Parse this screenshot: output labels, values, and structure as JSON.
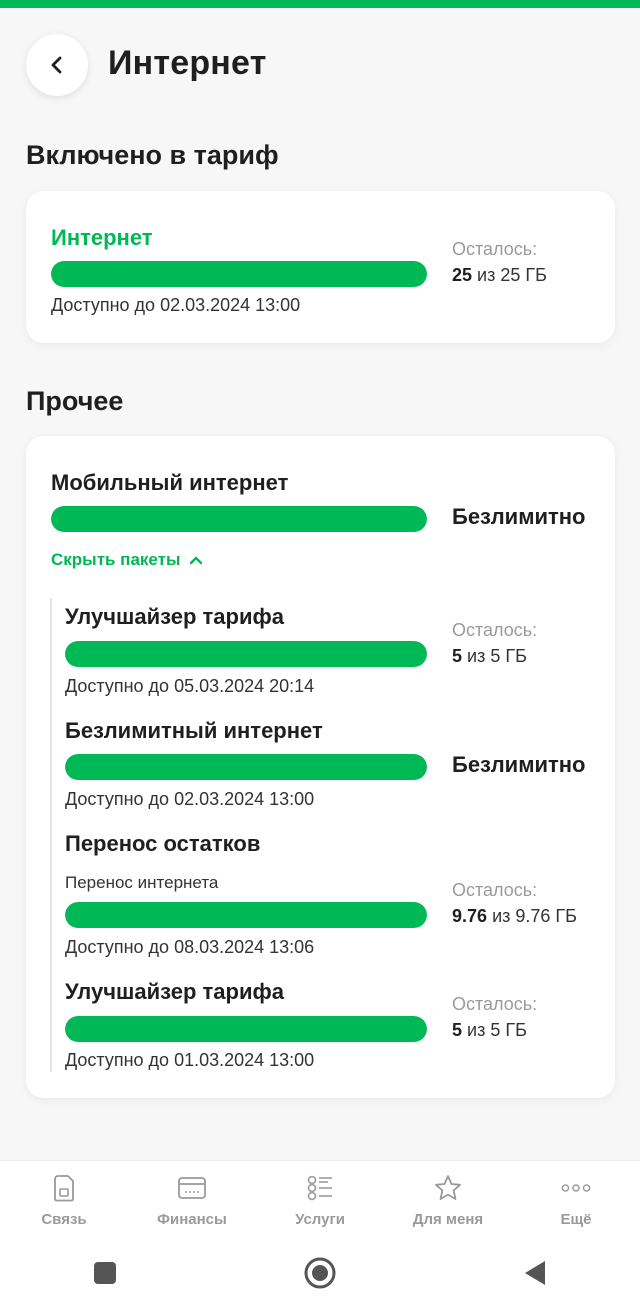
{
  "header": {
    "title": "Интернет"
  },
  "sections": {
    "included_title": "Включено в тариф",
    "other_title": "Прочее"
  },
  "included": {
    "name": "Интернет",
    "available": "Доступно до 02.03.2024 13:00",
    "remaining_label": "Осталось:",
    "remaining_value": "25",
    "remaining_suffix": "из 25 ГБ",
    "fill_fraction": 1.0
  },
  "other": {
    "mobile": {
      "name": "Мобильный интернет",
      "status": "Безлимитно",
      "fill_fraction": 1.0
    },
    "toggle_label": "Скрыть пакеты",
    "packages": [
      {
        "name": "Улучшайзер тарифа",
        "available": "Доступно до 05.03.2024 20:14",
        "remaining_label": "Осталось:",
        "remaining_value": "5",
        "remaining_suffix": "из 5 ГБ",
        "fill_fraction": 1.0
      },
      {
        "name": "Безлимитный интернет",
        "available": "Доступно до 02.03.2024 13:00",
        "status": "Безлимитно",
        "fill_fraction": 1.0
      },
      {
        "name": "Перенос остатков",
        "subtitle": "Перенос интернета",
        "available": "Доступно до 08.03.2024 13:06",
        "remaining_label": "Осталось:",
        "remaining_value": "9.76",
        "remaining_suffix": "из 9.76 ГБ",
        "fill_fraction": 1.0
      },
      {
        "name": "Улучшайзер тарифа",
        "available": "Доступно до 01.03.2024 13:00",
        "remaining_label": "Осталось:",
        "remaining_value": "5",
        "remaining_suffix": "из 5 ГБ",
        "fill_fraction": 1.0
      }
    ]
  },
  "nav": [
    {
      "label": "Связь",
      "icon": "sim-card-icon"
    },
    {
      "label": "Финансы",
      "icon": "wallet-icon"
    },
    {
      "label": "Услуги",
      "icon": "list-icon"
    },
    {
      "label": "Для меня",
      "icon": "star-icon"
    },
    {
      "label": "Ещё",
      "icon": "more-icon"
    }
  ],
  "colors": {
    "accent": "#00b956",
    "muted": "#9a9a9a"
  }
}
